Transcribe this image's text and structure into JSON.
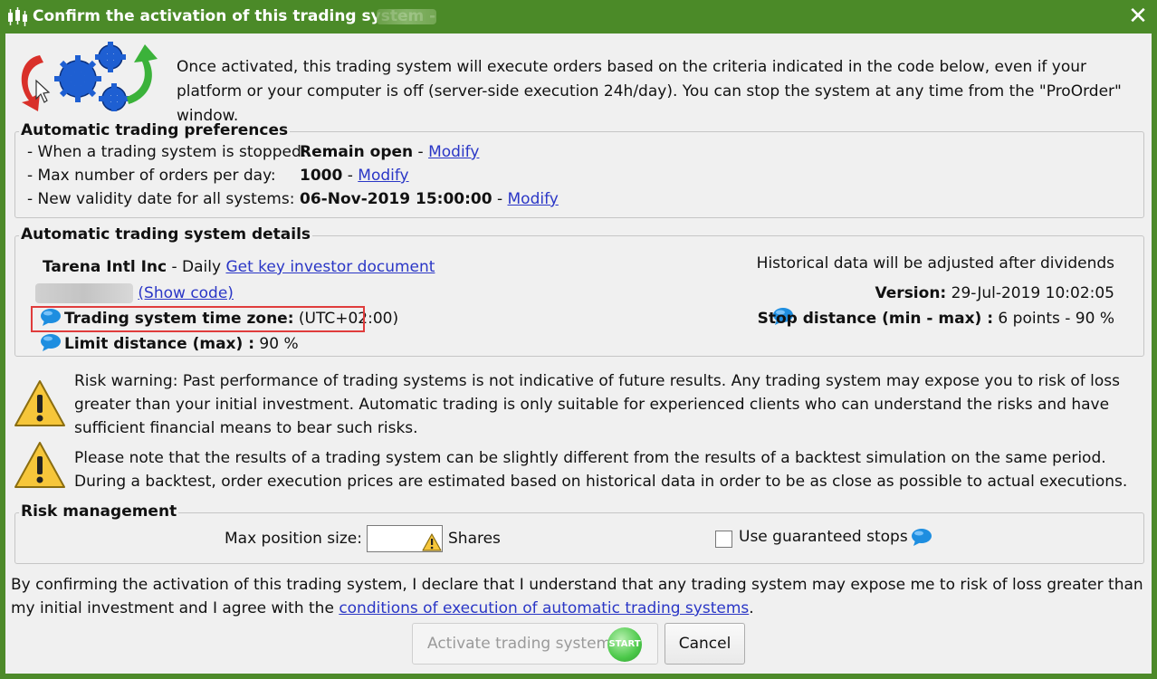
{
  "window": {
    "title": "Confirm the activation of this trading system -",
    "close_label": "✕",
    "app_icon": "candlestick-chart-icon",
    "close_icon": "close-icon"
  },
  "intro": {
    "icon": "activation-gears-icon",
    "text": "Once activated, this trading system will execute orders based on the criteria indicated in the code below, even if your platform or your computer is off (server-side execution 24h/day). You can stop the system at any time from the \"ProOrder\" window."
  },
  "preferences": {
    "legend": "Automatic trading preferences",
    "rows": [
      {
        "label": "- When a trading system is stopped:",
        "value": "Remain open",
        "sep": " -",
        "link": "Modify"
      },
      {
        "label": "- Max number of orders per day:",
        "value": "1000",
        "sep": " -",
        "link": "Modify"
      },
      {
        "label": "- New validity date for all systems:",
        "value": "06-Nov-2019 15:00:00",
        "sep": " -",
        "link": "Modify"
      }
    ]
  },
  "details": {
    "legend": "Automatic trading system details",
    "instrument_name": "Tarena Intl Inc",
    "instrument_period": " - Daily ",
    "kid_link": "Get key investor document",
    "show_code_link": "(Show code)",
    "timezone_label": "Trading system time zone:",
    "timezone_value": " (UTC+02:00)",
    "limit_label": "Limit distance (max) :",
    "limit_value": " 90 %",
    "dividends_note": "Historical data will be adjusted after dividends",
    "version_label": "Version:",
    "version_value": " 29-Jul-2019 10:02:05",
    "stop_label": "Stop distance (min - max) :",
    "stop_value": " 6 points - 90 %",
    "info_icon": "info-bubble-icon"
  },
  "warnings": {
    "icon": "warning-icon",
    "risk_text": "Risk warning: Past performance of trading systems is not indicative of future results. Any trading system may expose you to risk of loss greater than your initial investment. Automatic trading is only suitable for experienced clients who can understand the risks and have sufficient financial means to bear such risks.",
    "backtest_text": "Please note that the results of a trading system can be slightly different from the results of a backtest simulation on the same period. During a backtest, order execution prices are estimated based on historical data in order to be as close as possible to actual executions."
  },
  "risk": {
    "legend": "Risk management",
    "max_position_label": "Max position size:",
    "max_position_value": "",
    "units": "Shares",
    "guaranteed_label": "Use guaranteed stops",
    "guaranteed_checked": false
  },
  "footer": {
    "declaration_text": "By confirming the activation of this trading system, I declare that I understand that any trading system may expose me to risk of loss greater than my initial investment and I agree with the ",
    "conditions_link": "conditions of execution of automatic trading systems",
    "declaration_end": "."
  },
  "buttons": {
    "activate_label": "Activate trading system",
    "activate_badge": "START",
    "cancel_label": "Cancel"
  }
}
